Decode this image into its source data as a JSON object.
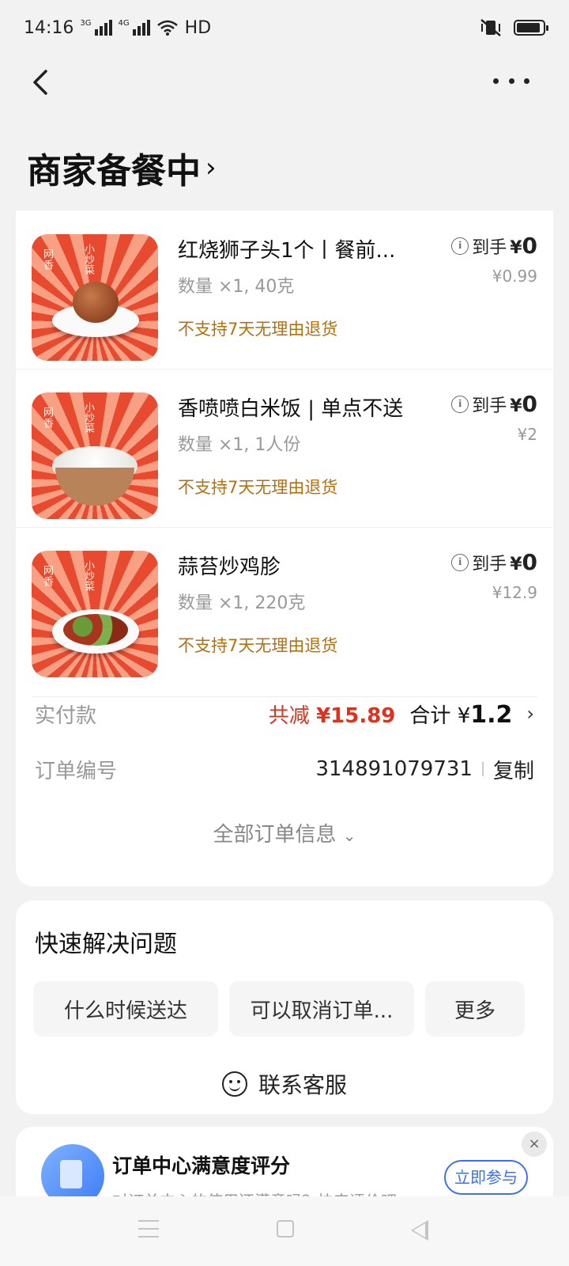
{
  "status_bar": {
    "time": "14:16",
    "net1": "3G",
    "net2": "4G",
    "hd": "HD",
    "battery_level": 0.9
  },
  "page": {
    "title": "商家备餐中",
    "title_chevron": "›"
  },
  "items": [
    {
      "name": "红烧狮子头1个丨餐前...",
      "qty": "数量 ×1, 40克",
      "policy": "不支持7天无理由退货",
      "final_label": "到手",
      "final_currency": "¥",
      "final_value": "0",
      "original_price": "¥0.99",
      "thumb_tag": "网香",
      "thumb_tag2": "小炒菜"
    },
    {
      "name": "香喷喷白米饭 | 单点不送",
      "qty": "数量 ×1, 1人份",
      "policy": "不支持7天无理由退货",
      "final_label": "到手",
      "final_currency": "¥",
      "final_value": "0",
      "original_price": "¥2",
      "thumb_tag": "网香",
      "thumb_tag2": "小炒菜"
    },
    {
      "name": "蒜苔炒鸡胗",
      "qty": "数量 ×1, 220克",
      "policy": "不支持7天无理由退货",
      "final_label": "到手",
      "final_currency": "¥",
      "final_value": "0",
      "original_price": "¥12.9",
      "thumb_tag": "网香",
      "thumb_tag2": "小炒菜"
    }
  ],
  "summary": {
    "paid_label": "实付款",
    "discount_label": "共减",
    "discount_value": "¥15.89",
    "total_label": "合计",
    "total_currency": "¥",
    "total_value": "1.2",
    "order_no_label": "订单编号",
    "order_no": "314891079731",
    "copy_label": "复制",
    "all_info_label": "全部订单信息"
  },
  "quick_help": {
    "title": "快速解决问题",
    "chips": [
      "什么时候送达",
      "可以取消订单...",
      "更多"
    ],
    "contact_label": "联系客服"
  },
  "survey": {
    "title": "订单中心满意度评分",
    "subtitle": "对订单中心的使用还满意吗？快来评价吧",
    "button": "立即参与",
    "close": "×"
  },
  "colors": {
    "accent_red": "#e0301e",
    "policy_brown": "#b07114",
    "survey_blue": "#3d6ff2"
  }
}
